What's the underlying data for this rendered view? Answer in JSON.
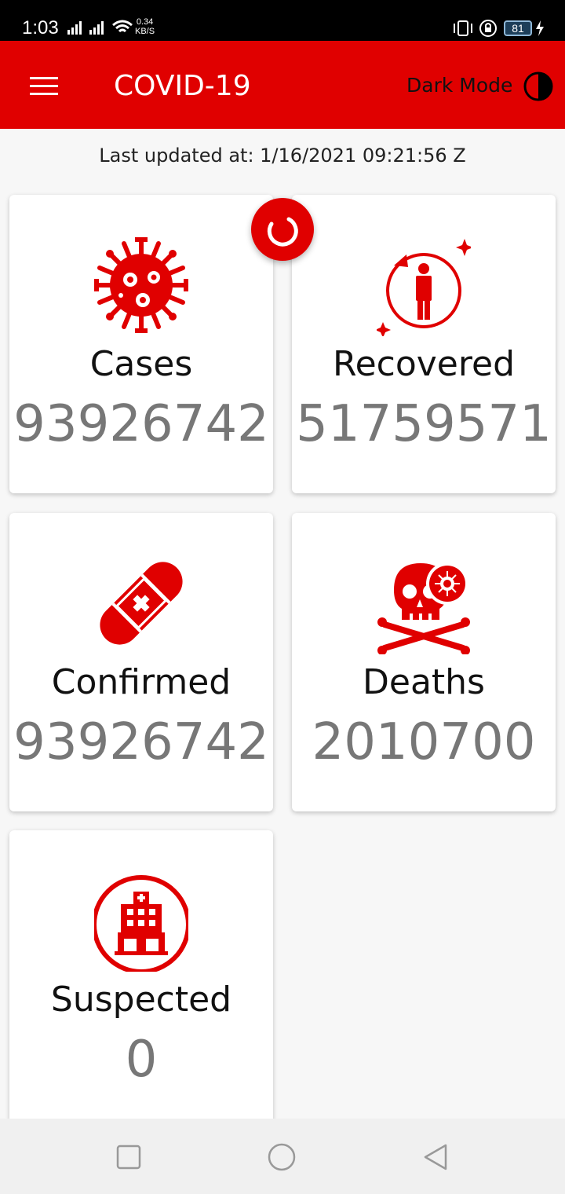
{
  "status_bar": {
    "time": "1:03",
    "net_speed_value": "0.34",
    "net_speed_unit": "KB/S",
    "battery": "81"
  },
  "app_bar": {
    "title": "COVID-19",
    "dark_mode_label": "Dark Mode"
  },
  "last_updated": "Last updated at: 1/16/2021 09:21:56 Z",
  "stats": {
    "cases": {
      "label": "Cases",
      "value": "93926742",
      "icon": "virus-icon"
    },
    "recovered": {
      "label": "Recovered",
      "value": "51759571",
      "icon": "recovered-person-icon"
    },
    "confirmed": {
      "label": "Confirmed",
      "value": "93926742",
      "icon": "bandage-icon"
    },
    "deaths": {
      "label": "Deaths",
      "value": "2010700",
      "icon": "skull-crossbones-icon"
    },
    "suspected": {
      "label": "Suspected",
      "value": "0",
      "icon": "hospital-icon"
    }
  },
  "colors": {
    "accent": "#e00000",
    "value_text": "#777777",
    "background": "#f7f7f7"
  }
}
